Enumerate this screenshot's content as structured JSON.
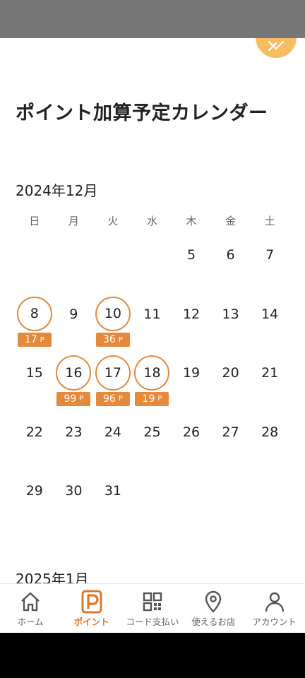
{
  "page_title": "ポイント加算予定カレンダー",
  "colors": {
    "accent": "#e58a3c",
    "close_button": "#f7bd63",
    "nav_active": "#e0782c"
  },
  "months": [
    {
      "title": "2024年12月",
      "weekdays": [
        "日",
        "月",
        "火",
        "水",
        "木",
        "金",
        "土"
      ],
      "leading_blanks": 4,
      "days": [
        {
          "day": "5"
        },
        {
          "day": "6"
        },
        {
          "day": "7"
        },
        {
          "day": "8",
          "points": "17"
        },
        {
          "day": "9"
        },
        {
          "day": "10",
          "points": "36"
        },
        {
          "day": "11"
        },
        {
          "day": "12"
        },
        {
          "day": "13"
        },
        {
          "day": "14"
        },
        {
          "day": "15"
        },
        {
          "day": "16",
          "points": "99"
        },
        {
          "day": "17",
          "points": "96"
        },
        {
          "day": "18",
          "points": "19"
        },
        {
          "day": "19"
        },
        {
          "day": "20"
        },
        {
          "day": "21"
        },
        {
          "day": "22"
        },
        {
          "day": "23"
        },
        {
          "day": "24"
        },
        {
          "day": "25"
        },
        {
          "day": "26"
        },
        {
          "day": "27"
        },
        {
          "day": "28"
        },
        {
          "day": "29"
        },
        {
          "day": "30"
        },
        {
          "day": "31"
        }
      ]
    },
    {
      "title": "2025年1月"
    }
  ],
  "point_unit": "P",
  "bottom_nav": [
    {
      "label": "ホーム",
      "icon": "home-icon",
      "active": false
    },
    {
      "label": "ポイント",
      "icon": "point-icon",
      "active": true
    },
    {
      "label": "コード支払い",
      "icon": "qr-code-icon",
      "active": false
    },
    {
      "label": "使えるお店",
      "icon": "location-pin-icon",
      "active": false
    },
    {
      "label": "アカウント",
      "icon": "account-icon",
      "active": false
    }
  ]
}
